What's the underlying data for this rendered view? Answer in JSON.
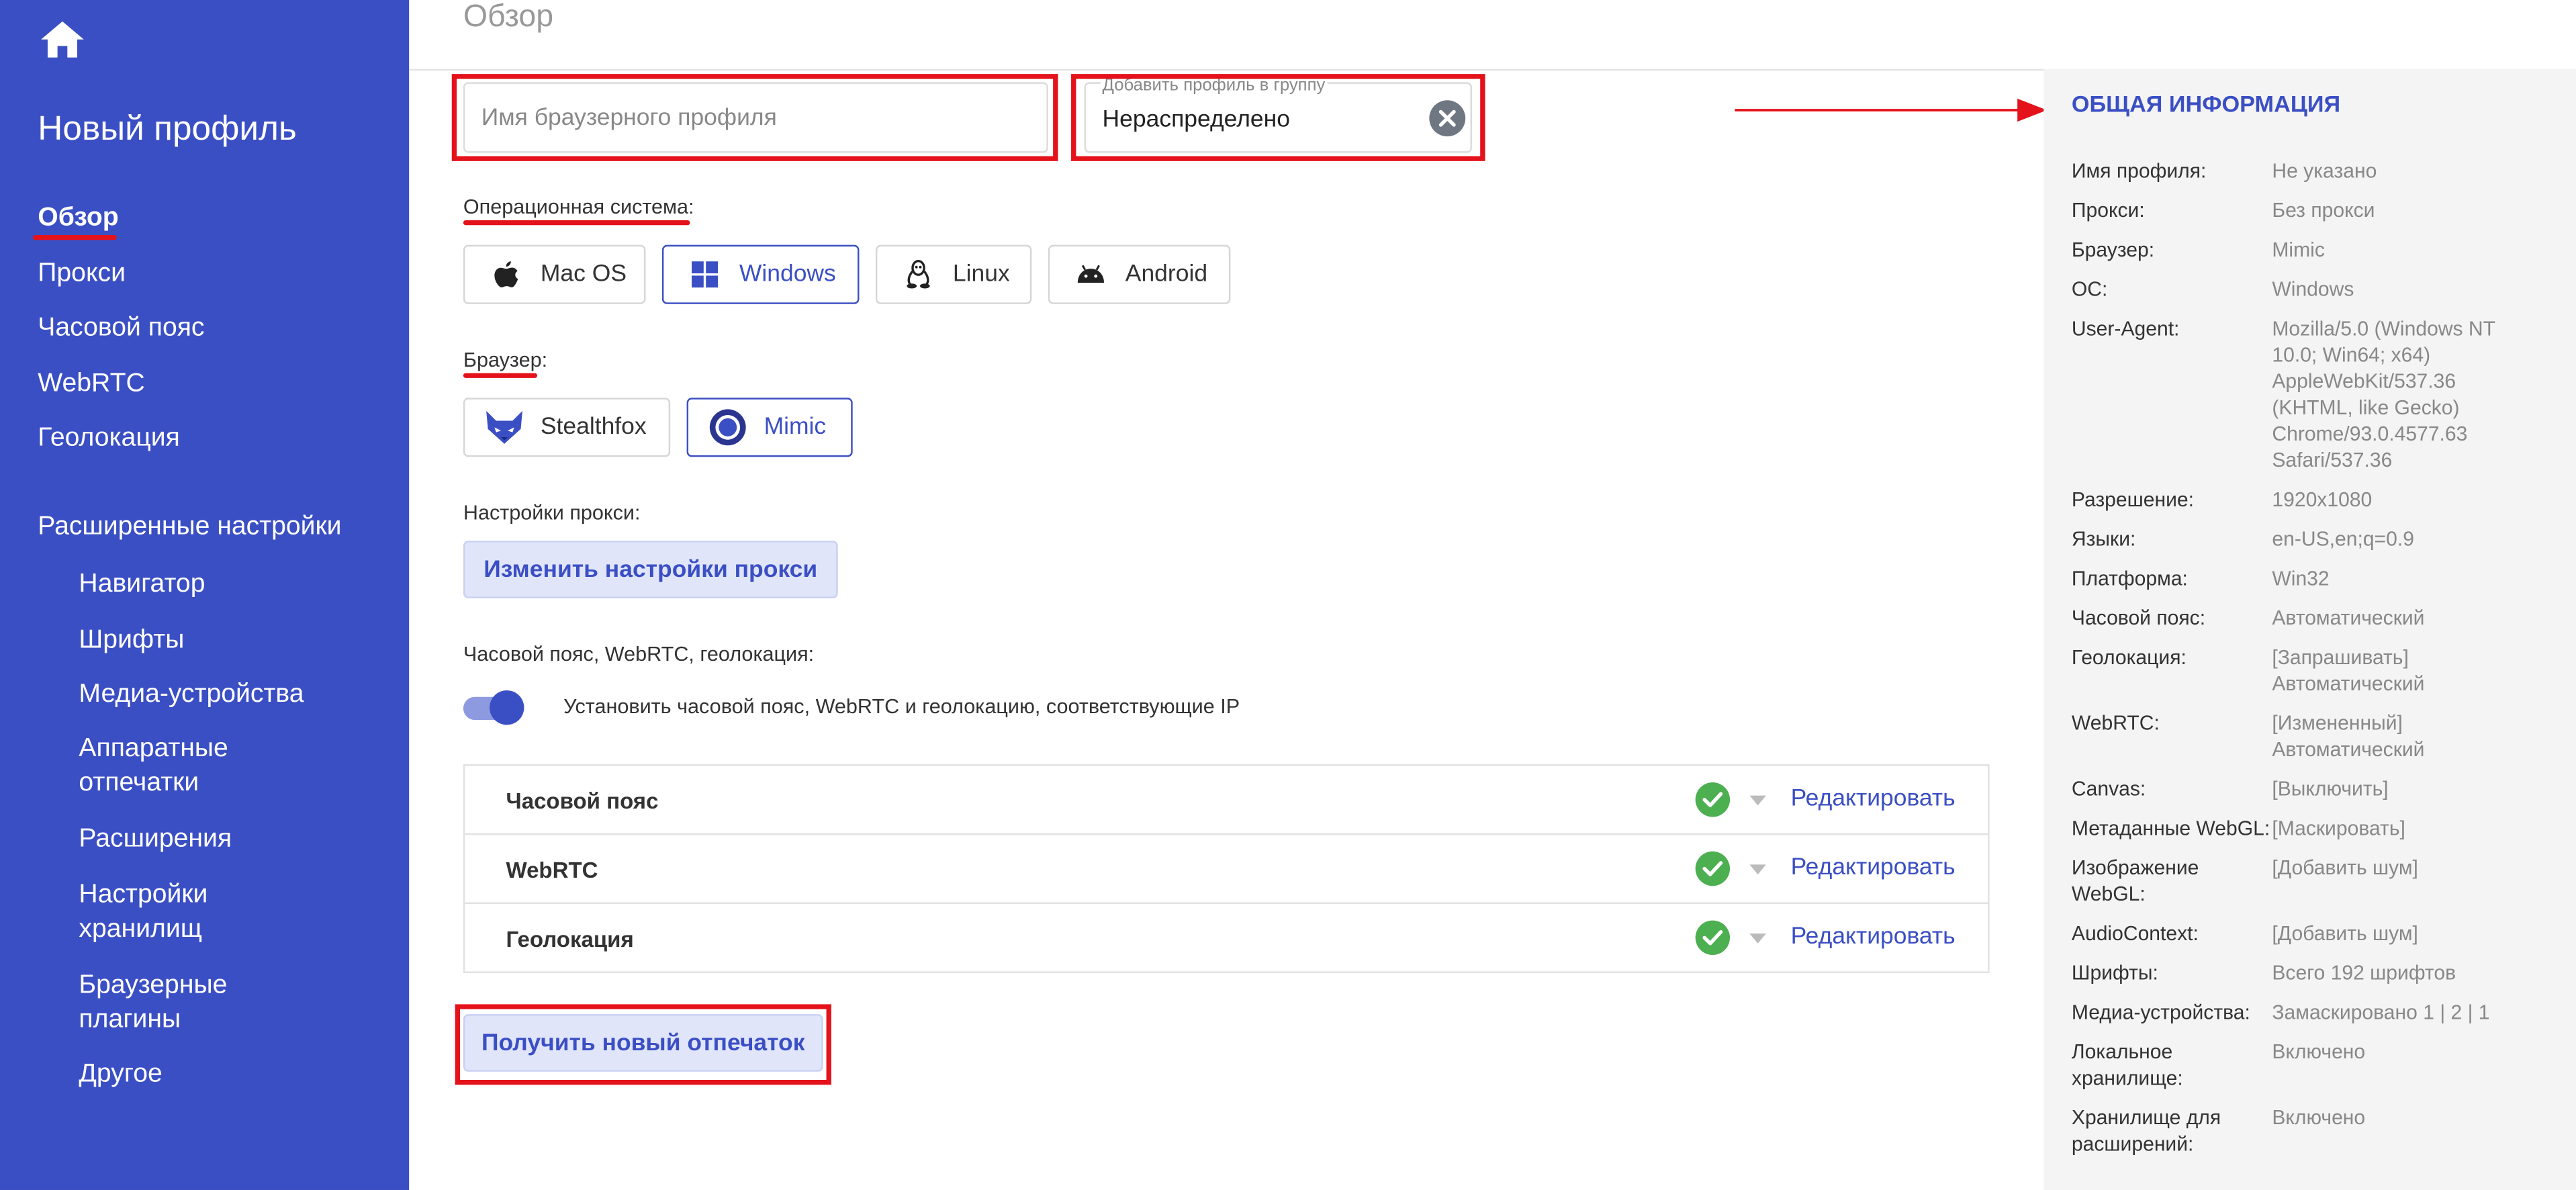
{
  "header": {
    "title": "Обзор"
  },
  "sidebar": {
    "title": "Новый профиль",
    "items": [
      {
        "label": "Обзор"
      },
      {
        "label": "Прокси"
      },
      {
        "label": "Часовой пояс"
      },
      {
        "label": "WebRTC"
      },
      {
        "label": "Геолокация"
      }
    ],
    "advanced_title": "Расширенные настройки",
    "advanced_items": [
      {
        "label": "Навигатор"
      },
      {
        "label": "Шрифты"
      },
      {
        "label": "Медиа-устройства"
      },
      {
        "label": "Аппаратные отпечатки"
      },
      {
        "label": "Расширения"
      },
      {
        "label": "Настройки хранилищ"
      },
      {
        "label": "Браузерные плагины"
      },
      {
        "label": "Другое"
      }
    ]
  },
  "form": {
    "profile_name_placeholder": "Имя браузерного профиля",
    "group_label": "Добавить профиль в группу",
    "group_value": "Нераспределено",
    "os_label": "Операционная система:",
    "os_options": [
      {
        "label": "Mac OS",
        "icon": "apple-icon"
      },
      {
        "label": "Windows",
        "icon": "windows-icon",
        "active": true
      },
      {
        "label": "Linux",
        "icon": "linux-icon"
      },
      {
        "label": "Android",
        "icon": "android-icon"
      }
    ],
    "browser_label": "Браузер:",
    "browser_options": [
      {
        "label": "Stealthfox",
        "icon": "stealthfox-icon"
      },
      {
        "label": "Mimic",
        "icon": "mimic-icon",
        "active": true
      }
    ],
    "proxy_label": "Настройки прокси:",
    "proxy_button": "Изменить настройки прокси",
    "tz_label": "Часовой пояс, WebRTC, геолокация:",
    "tz_toggle_text": "Установить часовой пояс, WebRTC и геолокацию, соответствующие IP",
    "tz_toggle_on": true,
    "tz_rows": [
      {
        "label": "Часовой пояс",
        "edit": "Редактировать"
      },
      {
        "label": "WebRTC",
        "edit": "Редактировать"
      },
      {
        "label": "Геолокация",
        "edit": "Редактировать"
      }
    ],
    "fingerprint_button": "Получить новый отпечаток"
  },
  "info": {
    "title": "ОБЩАЯ ИНФОРМАЦИЯ",
    "rows": [
      {
        "key": "Имя профиля:",
        "value": "Не указано"
      },
      {
        "key": "Прокси:",
        "value": "Без прокси"
      },
      {
        "key": "Браузер:",
        "value": "Mimic"
      },
      {
        "key": "ОС:",
        "value": "Windows"
      },
      {
        "key": "User-Agent:",
        "value": "Mozilla/5.0 (Windows NT 10.0; Win64; x64) AppleWebKit/537.36 (KHTML, like Gecko) Chrome/93.0.4577.63 Safari/537.36"
      },
      {
        "key": "Разрешение:",
        "value": "1920x1080"
      },
      {
        "key": "Языки:",
        "value": "en-US,en;q=0.9"
      },
      {
        "key": "Платформа:",
        "value": "Win32"
      },
      {
        "key": "Часовой пояс:",
        "value": "Автоматический"
      },
      {
        "key": "Геолокация:",
        "value": "[Запрашивать] Автоматический"
      },
      {
        "key": "WebRTC:",
        "value": "[Измененный] Автоматический"
      },
      {
        "key": "Canvas:",
        "value": "[Выключить]"
      },
      {
        "key": "Метаданные WebGL:",
        "value": "[Маскировать]"
      },
      {
        "key": "Изображение WebGL:",
        "value": "[Добавить шум]"
      },
      {
        "key": "AudioContext:",
        "value": "[Добавить шум]"
      },
      {
        "key": "Шрифты:",
        "value": "Всего 192 шрифтов"
      },
      {
        "key": "Медиа-устройства:",
        "value": "Замаскировано 1 | 2 | 1"
      },
      {
        "key": "Локальное хранилище:",
        "value": "Включено"
      },
      {
        "key": "Хранилище для расширений:",
        "value": "Включено"
      }
    ]
  },
  "colors": {
    "sidebar": "#3b4fc4",
    "accent": "#3b4fc4",
    "highlight": "#e4121a",
    "success": "#4caf50"
  }
}
